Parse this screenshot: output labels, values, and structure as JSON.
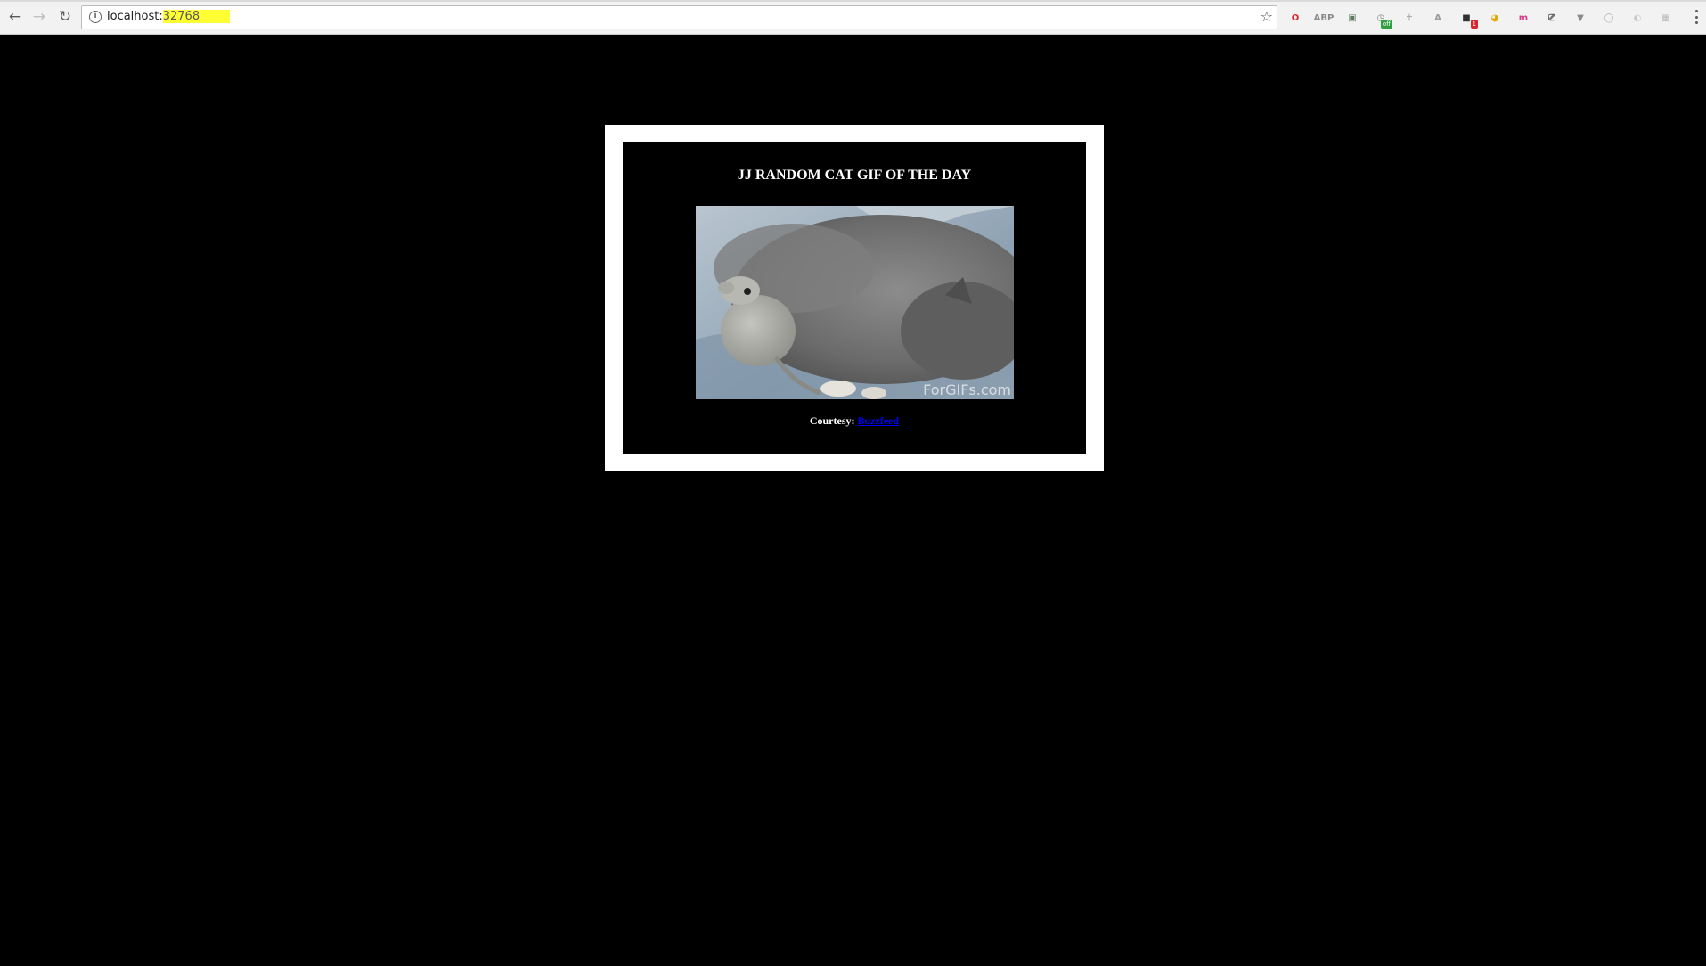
{
  "browser": {
    "url_host": "localhost:",
    "url_port": "32768",
    "extensions": [
      {
        "icon": "opera-icon",
        "glyph": "O",
        "color": "#d9262e"
      },
      {
        "icon": "adblock-plus-icon",
        "glyph": "ABP",
        "color": "#8a8a8a"
      },
      {
        "icon": "screen-capture-icon",
        "glyph": "▣",
        "color": "#5a7a5a"
      },
      {
        "icon": "clock-icon",
        "glyph": "◷",
        "color": "#7a7a7a",
        "badge": "off"
      },
      {
        "icon": "ankh-icon",
        "glyph": "☥",
        "color": "#9a9a9a"
      },
      {
        "icon": "angular-icon",
        "glyph": "A",
        "color": "#9a9a9a"
      },
      {
        "icon": "notification-icon",
        "glyph": "■",
        "color": "#303030",
        "badge": "1"
      },
      {
        "icon": "pacman-icon",
        "glyph": "◕",
        "color": "#e0a800"
      },
      {
        "icon": "m-icon",
        "glyph": "m",
        "color": "#d63d8c"
      },
      {
        "icon": "cast-icon",
        "glyph": "⎚",
        "color": "#5a5a5a"
      },
      {
        "icon": "vue-icon",
        "glyph": "▼",
        "color": "#8a8a8a"
      },
      {
        "icon": "circle-icon",
        "glyph": "◯",
        "color": "#b0b0b0"
      },
      {
        "icon": "moon-icon",
        "glyph": "◐",
        "color": "#c8c8c8"
      },
      {
        "icon": "grid-icon",
        "glyph": "▦",
        "color": "#b8b8b8"
      }
    ]
  },
  "page": {
    "title": "JJ RANDOM CAT GIF OF THE DAY",
    "gif_watermark": "ForGIFs.com",
    "courtesy_label": "Courtesy: ",
    "courtesy_link": "Buzzfeed"
  }
}
